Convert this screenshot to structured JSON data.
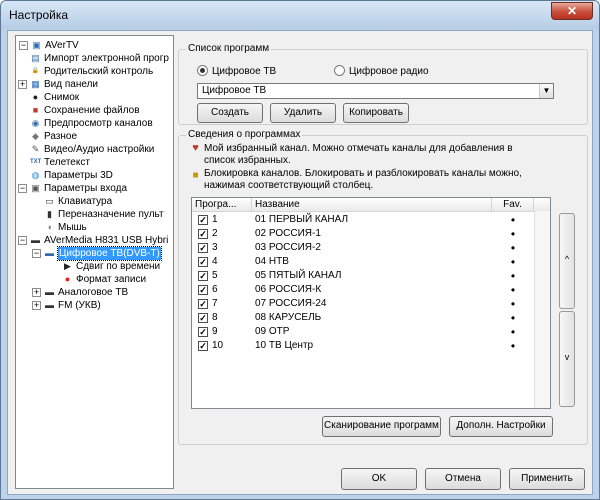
{
  "window": {
    "title": "Настройка",
    "close_glyph": "✕"
  },
  "tree": {
    "root": "AVerTV",
    "items": [
      {
        "label": "Импорт электронной прогр",
        "icon": "import-epg-icon",
        "glyph": "▤",
        "color": "#3a6ea5"
      },
      {
        "label": "Родительский контроль",
        "icon": "parental-lock-icon",
        "glyph": "🔒",
        "color": "#c89a00"
      },
      {
        "label": "Вид панели",
        "icon": "panel-view-icon",
        "glyph": "▦",
        "color": "#2b6cb0"
      },
      {
        "label": "Снимок",
        "icon": "snapshot-camera-icon",
        "glyph": "●",
        "color": "#222222"
      },
      {
        "label": "Сохранение файлов",
        "icon": "file-save-icon",
        "glyph": "■",
        "color": "#c0392b"
      },
      {
        "label": "Предпросмотр каналов",
        "icon": "channel-preview-icon",
        "glyph": "◉",
        "color": "#3a6ea5"
      },
      {
        "label": "Разное",
        "icon": "misc-tools-icon",
        "glyph": "◆",
        "color": "#777777"
      },
      {
        "label": "Видео/Аудио настройки",
        "icon": "av-settings-icon",
        "glyph": "✎",
        "color": "#555555"
      },
      {
        "label": "Телетекст",
        "icon": "teletext-icon",
        "glyph": "TXT",
        "color": "#2b6cb0"
      },
      {
        "label": "Параметры 3D",
        "icon": "3d-settings-icon",
        "glyph": "◍",
        "color": "#2b8fd6"
      },
      {
        "label": "Параметры входа",
        "icon": "input-settings-icon",
        "glyph": "▣",
        "color": "#555555"
      },
      {
        "label": "Клавиатура",
        "icon": "keyboard-icon",
        "glyph": "▭",
        "color": "#333333"
      },
      {
        "label": "Переназначение пульт",
        "icon": "remote-remap-icon",
        "glyph": "▮",
        "color": "#333333"
      },
      {
        "label": "Мышь",
        "icon": "mouse-icon",
        "glyph": "◖",
        "color": "#777777"
      },
      {
        "label": "AVerMedia H831 USB Hybri",
        "icon": "tv-device-icon",
        "glyph": "▬",
        "color": "#333333"
      },
      {
        "label": "Цифровое ТВ(DVB-T)",
        "icon": "digital-tv-icon",
        "glyph": "▬",
        "color": "#2b6cb0"
      },
      {
        "label": "Сдвиг по времени",
        "icon": "timeshift-icon",
        "glyph": "▶",
        "color": "#222222"
      },
      {
        "label": "Формат записи",
        "icon": "record-format-icon",
        "glyph": "●",
        "color": "#e0201b"
      },
      {
        "label": "Аналоговое ТВ",
        "icon": "analog-tv-icon",
        "glyph": "▬",
        "color": "#333333"
      },
      {
        "label": "FM (УКВ)",
        "icon": "fm-radio-icon",
        "glyph": "▬",
        "color": "#333333"
      }
    ]
  },
  "program_list": {
    "title": "Список программ",
    "radio_digital": "Цифровое ТВ",
    "radio_radio": "Цифровое радио",
    "combo_value": "Цифровое ТВ",
    "create": "Создать",
    "delete": "Удалить",
    "copy": "Копировать"
  },
  "program_info": {
    "title": "Сведения о программах",
    "favorite_text": "Мой избранный канал. Можно отмечать каналы для добавления в список избранных.",
    "lock_text": "Блокировка каналов. Блокировать и разблокировать каналы можно, нажимая соответствующий столбец."
  },
  "table": {
    "columns": [
      "Програ...",
      "Название",
      "Fav."
    ],
    "rows": [
      {
        "num": "1",
        "name": "01 ПЕРВЫЙ КАНАЛ",
        "fav": "•"
      },
      {
        "num": "2",
        "name": "02 РОССИЯ-1",
        "fav": "•"
      },
      {
        "num": "3",
        "name": "03 РОССИЯ-2",
        "fav": "•"
      },
      {
        "num": "4",
        "name": "04 НТВ",
        "fav": "•"
      },
      {
        "num": "5",
        "name": "05 ПЯТЫЙ КАНАЛ",
        "fav": "•"
      },
      {
        "num": "6",
        "name": "06 РОССИЯ-К",
        "fav": "•"
      },
      {
        "num": "7",
        "name": "07 РОССИЯ-24",
        "fav": "•"
      },
      {
        "num": "8",
        "name": "08 КАРУСЕЛЬ",
        "fav": "•"
      },
      {
        "num": "9",
        "name": "09 ОТР",
        "fav": "•"
      },
      {
        "num": "10",
        "name": "10 ТВ Центр",
        "fav": "•"
      }
    ]
  },
  "side_buttons": {
    "up": "^",
    "down": "v"
  },
  "actions": {
    "scan": "Сканирование программ",
    "advanced": "Дополн. Настройки"
  },
  "footer": {
    "ok": "OK",
    "cancel": "Отмена",
    "apply": "Применить"
  }
}
